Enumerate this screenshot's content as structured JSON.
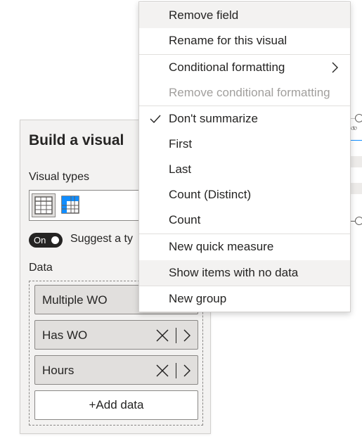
{
  "pane": {
    "title": "Build a visual",
    "visual_types_label": "Visual types",
    "toggle_label": "On",
    "suggest_label": "Suggest a ty",
    "data_label": "Data",
    "fields": [
      {
        "name": "Multiple WO"
      },
      {
        "name": "Has WO"
      },
      {
        "name": "Hours"
      }
    ],
    "add_data_label": "+Add data"
  },
  "context_menu": {
    "items": [
      {
        "label": "Remove field",
        "state": "hover"
      },
      {
        "label": "Rename for this visual"
      },
      {
        "label": "Conditional formatting",
        "submenu": true
      },
      {
        "label": "Remove conditional formatting",
        "state": "disabled"
      },
      {
        "label": "Don't summarize",
        "checked": true
      },
      {
        "label": "First"
      },
      {
        "label": "Last"
      },
      {
        "label": "Count (Distinct)"
      },
      {
        "label": "Count"
      },
      {
        "label": "New quick measure"
      },
      {
        "label": "Show items with no data",
        "state": "hover"
      },
      {
        "label": "New group"
      }
    ]
  },
  "colors": {
    "pane_bg": "#f3f2f1",
    "pill_bg": "#e1dfdd",
    "text": "#252423",
    "disabled_text": "#a19f9d",
    "table_accent": "#118dff"
  },
  "icons": {
    "table": "table-icon",
    "matrix": "matrix-icon",
    "remove": "close-icon",
    "expand": "chevron-right-icon",
    "check": "checkmark-icon",
    "submenu": "chevron-right-icon"
  }
}
